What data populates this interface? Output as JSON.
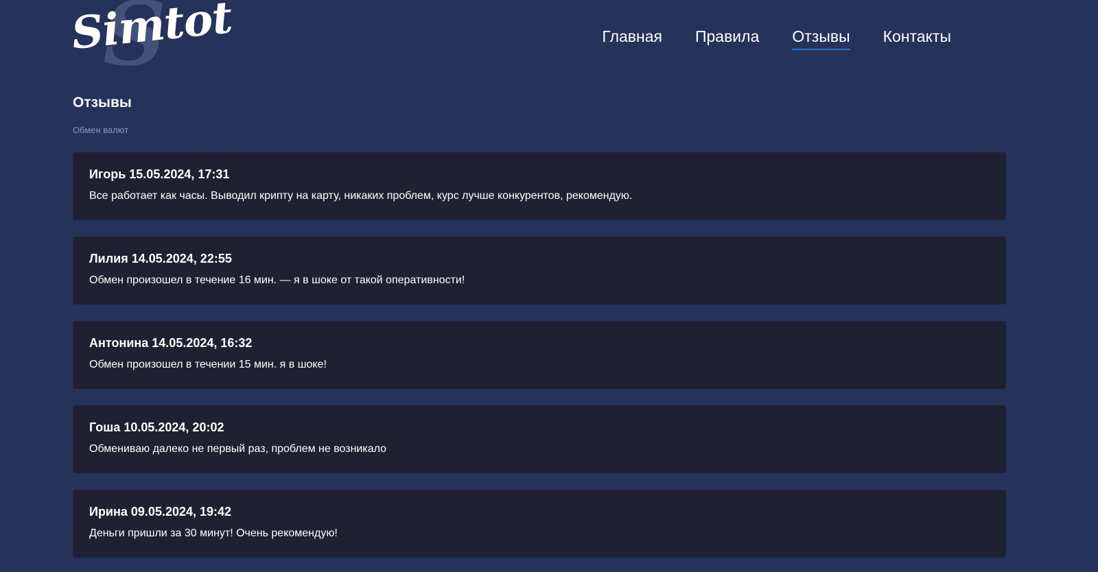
{
  "logo": {
    "text": "Simtot",
    "bg_letter": "S"
  },
  "nav": {
    "items": [
      {
        "label": "Главная",
        "active": false
      },
      {
        "label": "Правила",
        "active": false
      },
      {
        "label": "Отзывы",
        "active": true
      },
      {
        "label": "Контакты",
        "active": false
      }
    ]
  },
  "page": {
    "title": "Отзывы",
    "subtitle": "Обмен валют"
  },
  "reviews": [
    {
      "name": "Игорь",
      "datetime": "15.05.2024, 17:31",
      "text": "Все работает как часы. Выводил крипту на карту, никаких проблем, курс лучше конкурентов, рекомендую."
    },
    {
      "name": "Лилия",
      "datetime": "14.05.2024, 22:55",
      "text": "Обмен произошел в течение 16 мин. — я в шоке от такой оперативности!"
    },
    {
      "name": "Антонина",
      "datetime": "14.05.2024, 16:32",
      "text": "Обмен произошел в течении 15 мин. я в шоке!"
    },
    {
      "name": "Гоша",
      "datetime": "10.05.2024, 20:02",
      "text": "Обмениваю далеко не первый раз, проблем не возникало"
    },
    {
      "name": "Ирина",
      "datetime": "09.05.2024, 19:42",
      "text": "Деньги пришли за 30 минут! Очень рекомендую!"
    }
  ],
  "colors": {
    "background": "#25325a",
    "card": "#1f2133",
    "accent": "#2f6fd6",
    "subtitle": "#8e98b4"
  }
}
